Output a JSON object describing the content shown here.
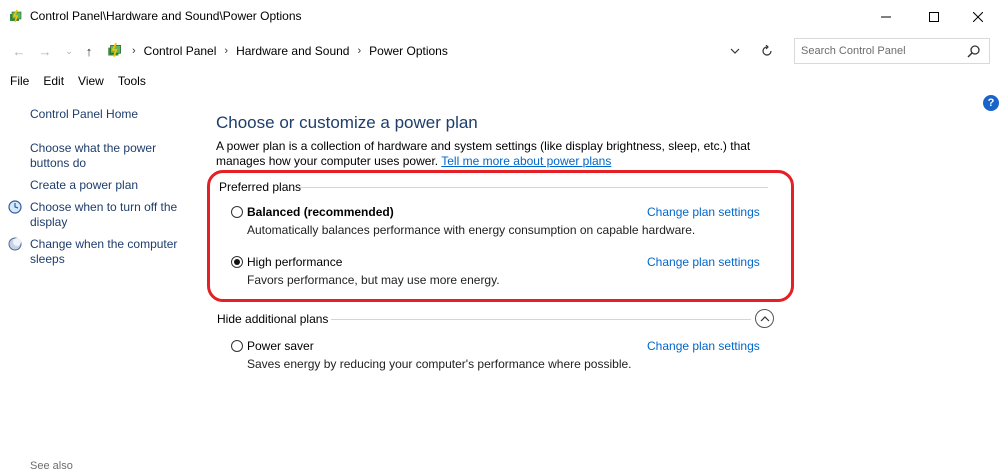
{
  "window": {
    "title": "Control Panel\\Hardware and Sound\\Power Options",
    "minimize_icon": "minimize-icon",
    "maximize_icon": "maximize-icon",
    "close_icon": "close-icon"
  },
  "address": {
    "breadcrumbs": [
      "Control Panel",
      "Hardware and Sound",
      "Power Options"
    ],
    "search_placeholder": "Search Control Panel"
  },
  "menu": [
    "File",
    "Edit",
    "View",
    "Tools"
  ],
  "sidebar": {
    "home": "Control Panel Home",
    "links": [
      "Choose what the power buttons do",
      "Create a power plan",
      "Choose when to turn off the display",
      "Change when the computer sleeps"
    ],
    "see_also": "See also"
  },
  "main": {
    "title": "Choose or customize a power plan",
    "intro_text": "A power plan is a collection of hardware and system settings (like display brightness, sleep, etc.) that manages how your computer uses power.",
    "intro_link": "Tell me more about power plans",
    "preferred_label": "Preferred plans",
    "hide_label": "Hide additional plans",
    "plans": [
      {
        "name": "Balanced (recommended)",
        "description": "Automatically balances performance with energy consumption on capable hardware.",
        "link": "Change plan settings",
        "selected": false
      },
      {
        "name": "High performance",
        "description": "Favors performance, but may use more energy.",
        "link": "Change plan settings",
        "selected": true
      },
      {
        "name": "Power saver",
        "description": "Saves energy by reducing your computer's performance where possible.",
        "link": "Change plan settings",
        "selected": false
      }
    ]
  },
  "colors": {
    "link": "#0066cc",
    "heading": "#1e3d6b",
    "highlight": "#e41f26"
  }
}
